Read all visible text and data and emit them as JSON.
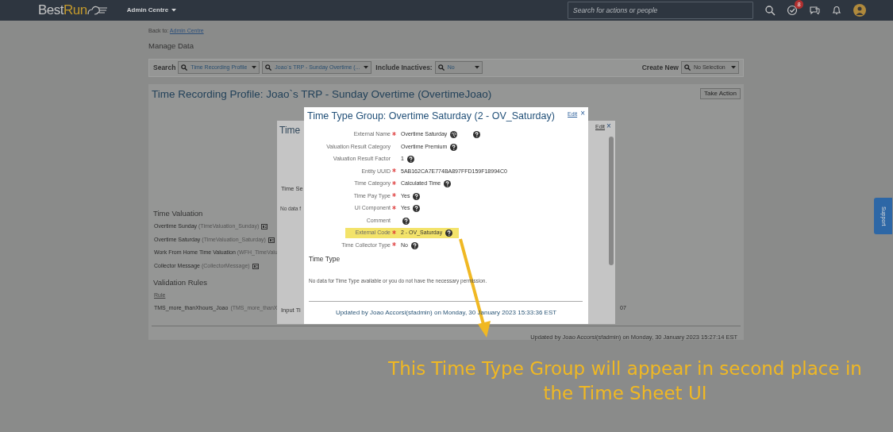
{
  "navbar": {
    "logo_part1": "Best",
    "logo_part2": "Run",
    "menu": "Admin Centre",
    "search": {
      "placeholder": "Search for actions or people"
    },
    "notification_count": "8"
  },
  "breadcrumb": {
    "prefix": "Back to:",
    "link": "Admin Centre"
  },
  "page_title": "Manage Data",
  "search_bar": {
    "label": "Search",
    "filters": [
      {
        "value": "Time Recording Profile"
      },
      {
        "value": "Joao`s TRP - Sunday Overtime (..."
      }
    ],
    "inactives_label": "Include Inactives:",
    "inactives_value": "No",
    "create_label": "Create New",
    "create_value": "No Selection"
  },
  "profile": {
    "title": "Time Recording Profile: Joao`s TRP - Sunday Overtime (OvertimeJoao)",
    "action_button": "Take Action",
    "time_valuation": {
      "heading": "Time Valuation",
      "items": [
        {
          "name": "Overtime Sunday",
          "code": "(TimeValuation_Sunday)",
          "icon": true
        },
        {
          "name": "Overtime Saturday",
          "code": "(TimeValuation_Saturday)",
          "icon": true
        },
        {
          "name": "Work From Home Time Valuation",
          "code": "(WFH_TimeValu",
          "icon": false
        },
        {
          "name": "Collector Message",
          "code": "(CollectorMessage)",
          "icon": true
        }
      ]
    },
    "validation_rules": {
      "heading": "Validation Rules",
      "column": "Rule",
      "rows": [
        {
          "name": "TMS_more_thanXhours_Joao",
          "code": "(TMS_more_thanX",
          "column_2": "07"
        }
      ]
    },
    "updated": "Updated by Joao Accorsi(sfadmin) on Monday, 30 January 2023 15:27:14 EST"
  },
  "middle_dialog": {
    "title": "Time",
    "edit": "Edit",
    "close": "×",
    "section": "Time Se",
    "no_data": "No data f",
    "bottom_section": "Input Ti"
  },
  "dialog": {
    "title": "Time Type Group: Overtime Saturday (2 - OV_Saturday)",
    "edit": "Edit",
    "close": "×",
    "fields": [
      {
        "label": "External Name",
        "required": true,
        "value": "Overtime Saturday",
        "translate_icon": true,
        "help": true,
        "highlighted": false
      },
      {
        "label": "Valuation Result Category",
        "required": false,
        "value": "Overtime Premium",
        "translate_icon": false,
        "help": true,
        "highlighted": false
      },
      {
        "label": "Valuation Result Factor",
        "required": false,
        "value": "1",
        "translate_icon": false,
        "help": true,
        "highlighted": false
      },
      {
        "label": "Entity UUID",
        "required": true,
        "value": "5AB162CA7E774BA897FFD159F18994C0",
        "translate_icon": false,
        "help": false,
        "highlighted": false
      },
      {
        "label": "Time Category",
        "required": true,
        "value": "Calculated Time",
        "translate_icon": false,
        "help": true,
        "highlighted": false
      },
      {
        "label": "Time Pay Type",
        "required": true,
        "value": "Yes",
        "translate_icon": false,
        "help": true,
        "highlighted": false
      },
      {
        "label": "UI Component",
        "required": true,
        "value": "Yes",
        "translate_icon": false,
        "help": true,
        "highlighted": false
      },
      {
        "label": "Comment",
        "required": false,
        "translate_icon": false,
        "help": true,
        "highlighted": false
      },
      {
        "label": "External Code",
        "required": true,
        "value": "2 - OV_Saturday",
        "translate_icon": false,
        "help": true,
        "highlighted": true
      },
      {
        "label": "Time Collector Type",
        "required": true,
        "value": "No",
        "translate_icon": false,
        "help": true,
        "highlighted": false
      }
    ],
    "section": "Time Type",
    "no_data": "No data for Time Type available or you do not have the necessary permission.",
    "updated": "Updated by Joao Accorsi(sfadmin) on Monday, 30 January 2023 15:33:36 EST"
  },
  "annotation": "This Time Type Group will appear in second place in the Time Sheet UI",
  "support_tab": "Support"
}
